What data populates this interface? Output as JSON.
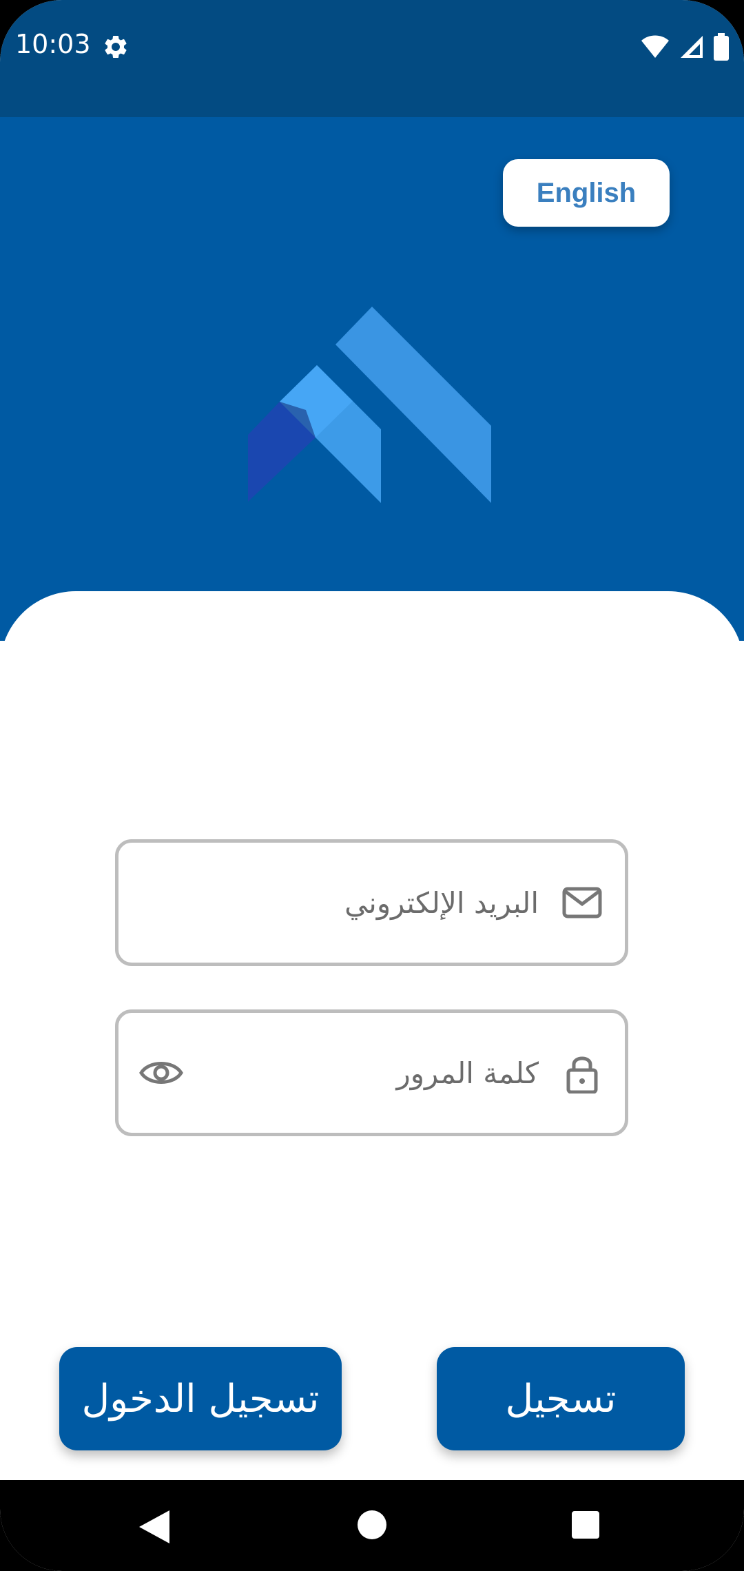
{
  "status_bar": {
    "time": "10:03",
    "icons": [
      "gear-icon",
      "wifi-icon",
      "signal-icon",
      "battery-icon"
    ]
  },
  "header": {
    "language_button_label": "English",
    "logo": "app-logo"
  },
  "form": {
    "email_placeholder": "البريد الإلكتروني",
    "email_icon": "envelope-icon",
    "password_placeholder": "كلمة المرور",
    "password_icon": "lock-icon",
    "password_toggle_icon": "eye-icon"
  },
  "actions": {
    "login_label": "تسجيل الدخول",
    "register_label": "تسجيل"
  },
  "nav_bar": {
    "icons": [
      "back-icon",
      "home-icon",
      "recents-icon"
    ]
  },
  "colors": {
    "primary": "#005aa3",
    "status_bar": "#034b82",
    "link_text": "#3a7fbf",
    "field_border": "#bdbdbd"
  }
}
